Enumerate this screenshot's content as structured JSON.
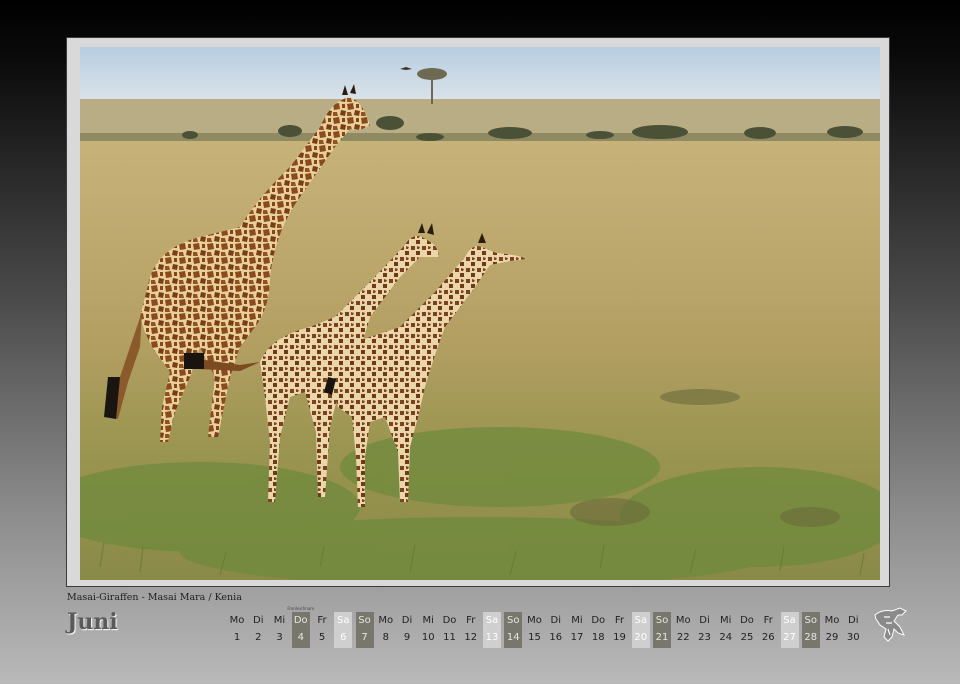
{
  "caption": "Masai-Giraffen - Masai Mara / Kenia",
  "month": "Juni",
  "holiday_note": "Fronleichnam",
  "days": [
    {
      "dn": "Mo",
      "num": "1",
      "kind": "weekday"
    },
    {
      "dn": "Di",
      "num": "2",
      "kind": "weekday"
    },
    {
      "dn": "Mi",
      "num": "3",
      "kind": "weekday"
    },
    {
      "dn": "Do",
      "num": "4",
      "kind": "holiday"
    },
    {
      "dn": "Fr",
      "num": "5",
      "kind": "weekday"
    },
    {
      "dn": "Sa",
      "num": "6",
      "kind": "sat"
    },
    {
      "dn": "So",
      "num": "7",
      "kind": "sun"
    },
    {
      "dn": "Mo",
      "num": "8",
      "kind": "weekday"
    },
    {
      "dn": "Di",
      "num": "9",
      "kind": "weekday"
    },
    {
      "dn": "Mi",
      "num": "10",
      "kind": "weekday"
    },
    {
      "dn": "Do",
      "num": "11",
      "kind": "weekday"
    },
    {
      "dn": "Fr",
      "num": "12",
      "kind": "weekday"
    },
    {
      "dn": "Sa",
      "num": "13",
      "kind": "sat"
    },
    {
      "dn": "So",
      "num": "14",
      "kind": "sun"
    },
    {
      "dn": "Mo",
      "num": "15",
      "kind": "weekday"
    },
    {
      "dn": "Di",
      "num": "16",
      "kind": "weekday"
    },
    {
      "dn": "Mi",
      "num": "17",
      "kind": "weekday"
    },
    {
      "dn": "Do",
      "num": "18",
      "kind": "weekday"
    },
    {
      "dn": "Fr",
      "num": "19",
      "kind": "weekday"
    },
    {
      "dn": "Sa",
      "num": "20",
      "kind": "sat"
    },
    {
      "dn": "So",
      "num": "21",
      "kind": "sun"
    },
    {
      "dn": "Mo",
      "num": "22",
      "kind": "weekday"
    },
    {
      "dn": "Di",
      "num": "23",
      "kind": "weekday"
    },
    {
      "dn": "Mi",
      "num": "24",
      "kind": "weekday"
    },
    {
      "dn": "Do",
      "num": "25",
      "kind": "weekday"
    },
    {
      "dn": "Fr",
      "num": "26",
      "kind": "weekday"
    },
    {
      "dn": "Sa",
      "num": "27",
      "kind": "sat"
    },
    {
      "dn": "So",
      "num": "28",
      "kind": "sun"
    },
    {
      "dn": "Mo",
      "num": "29",
      "kind": "weekday"
    },
    {
      "dn": "Di",
      "num": "30",
      "kind": "weekday"
    }
  ],
  "colors": {
    "saturday": "#cfcfcf",
    "sunday": "#77776d",
    "savanna": "#b8a266",
    "sky": "#c9dbe8"
  },
  "icons": {
    "logo": "giraffe-logo-icon"
  }
}
